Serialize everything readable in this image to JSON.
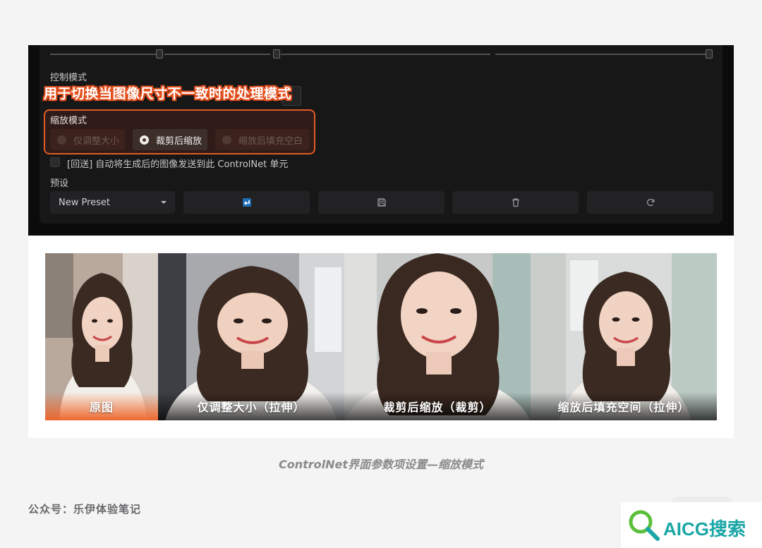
{
  "panel": {
    "control_mode_label": "控制模式",
    "annotation": "用于切换当图像尺寸不一致时的处理模式",
    "resize_mode_label": "缩放模式",
    "resize_options": [
      "仅调整大小",
      "裁剪后缩放",
      "缩放后填充空白"
    ],
    "resize_selected": "裁剪后缩放",
    "loopback_label": "[回送] 自动将生成后的图像发送到此 ControlNet 单元",
    "preset_label": "预设",
    "preset_value": "New Preset",
    "toolbar_icons": [
      "send-back-icon",
      "save-icon",
      "trash-icon",
      "refresh-icon"
    ]
  },
  "photos": [
    {
      "caption": "原图",
      "style": "orange"
    },
    {
      "caption": "仅调整大小（拉伸）",
      "style": "dark"
    },
    {
      "caption": "裁剪后缩放（裁剪）",
      "style": "dark"
    },
    {
      "caption": "缩放后填充空间（拉伸）",
      "style": "dark"
    }
  ],
  "figure_caption": "ControlNet界面参数项设置—缩放模式",
  "footer": {
    "wechat": "公众号：乐伊体验笔记",
    "brand": "AICG搜索"
  },
  "colors": {
    "accent": "#e25a26",
    "panel_bg": "#0b0b0c",
    "brand": "#1aa6a6"
  }
}
